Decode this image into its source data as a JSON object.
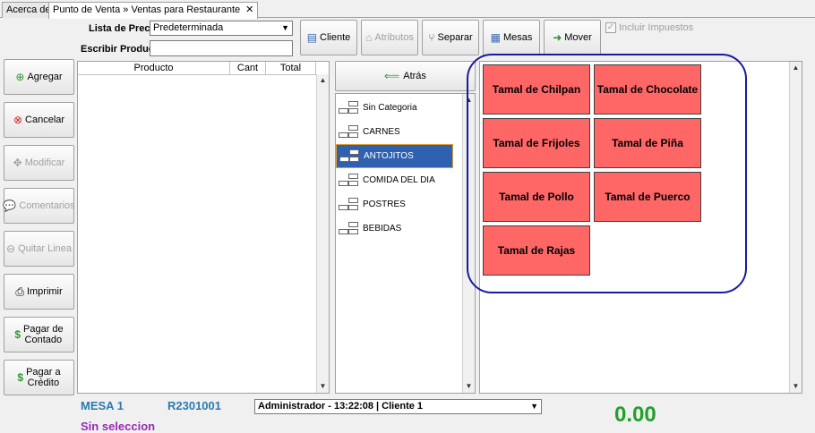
{
  "tabs": [
    {
      "label": "Acerca de"
    },
    {
      "label": "Punto de Venta » Ventas para Restaurante",
      "close": "✕"
    }
  ],
  "form": {
    "price_list_label": "Lista de Precios",
    "price_list_value": "Predeterminada",
    "product_label": "Escribir Producto",
    "product_value": ""
  },
  "toolbar": {
    "cliente": "Cliente",
    "atributos": "Atributos",
    "separar": "Separar",
    "mesas": "Mesas",
    "mover": "Mover",
    "incluir_impuestos": "Incluir Impuestos"
  },
  "side_buttons": {
    "agregar": "Agregar",
    "cancelar": "Cancelar",
    "modificar": "Modificar",
    "comentarios": "Comentarios",
    "quitar": "Quitar Linea",
    "imprimir": "Imprimir",
    "pagar_contado_1": "Pagar de",
    "pagar_contado_2": "Contado",
    "pagar_credito_1": "Pagar a",
    "pagar_credito_2": "Crédito"
  },
  "grid": {
    "columns": [
      "Producto",
      "Cant",
      "Total"
    ]
  },
  "back_label": "Atrás",
  "categories": [
    "Sin Categoria",
    "CARNES",
    "ANTOJITOS",
    "COMIDA DEL DIA",
    "POSTRES",
    "BEBIDAS"
  ],
  "selected_category": "ANTOJITOS",
  "products": [
    "Tamal de Chilpan",
    "Tamal de Chocolate",
    "Tamal de Frijoles",
    "Tamal de Piña",
    "Tamal de Pollo",
    "Tamal de Puerco",
    "Tamal de Rajas"
  ],
  "status": {
    "mesa": "MESA 1",
    "folio": "R2301001",
    "session": "Administrador - 13:22:08 | Cliente 1",
    "selection": "Sin seleccion",
    "total": "0.00"
  },
  "colors": {
    "product_bg": "#ff6666",
    "selected_category_bg": "#3060b0",
    "total_color": "#22a02a",
    "mesa_color": "#2a7ab0",
    "selection_color": "#9a2ab0",
    "highlight_border": "#1a1aa0"
  }
}
